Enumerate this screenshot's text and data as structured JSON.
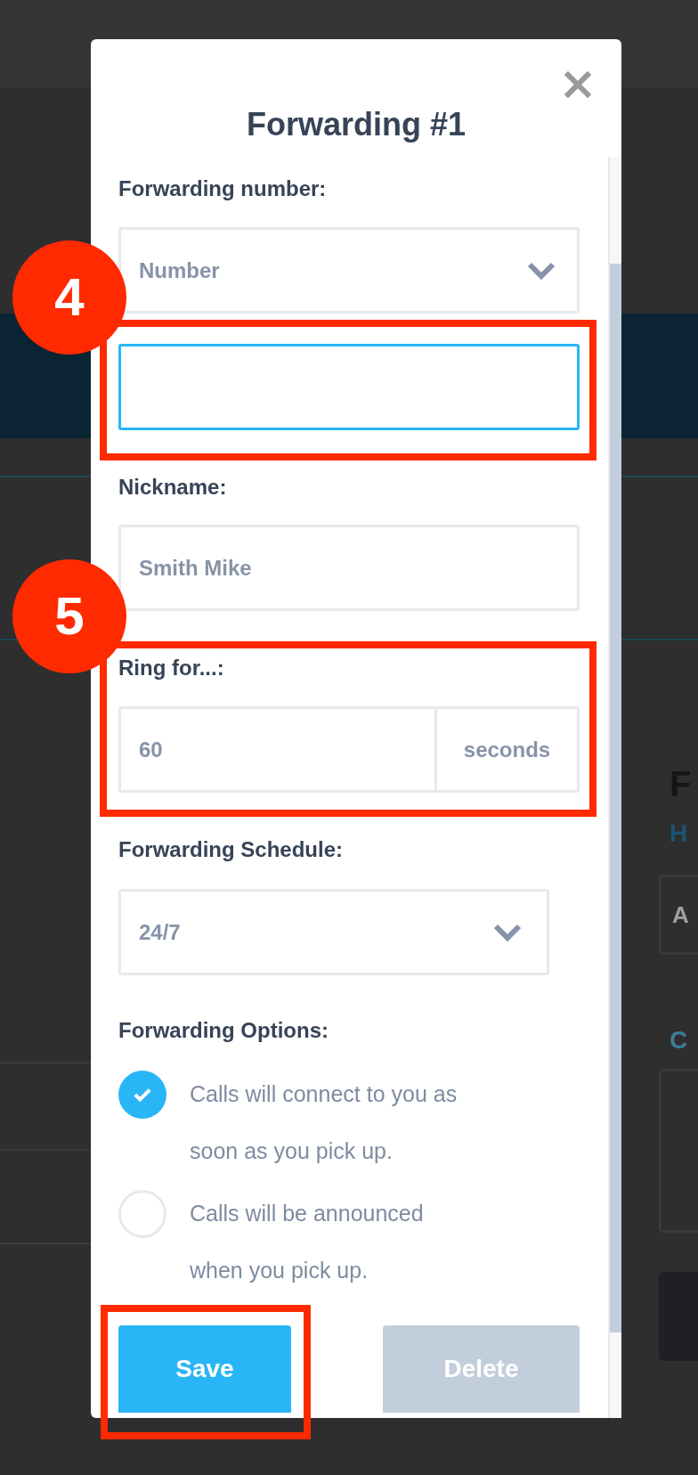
{
  "background_page": {
    "heading": "F",
    "link": "H",
    "field_value": "A",
    "label": "C"
  },
  "dialog": {
    "title": "Forwarding #1",
    "forwarding_number": {
      "label": "Forwarding number:",
      "select_value": "Number",
      "input": {
        "focused": true,
        "highlighted": true,
        "callout": "4"
      }
    },
    "nickname": {
      "label": "Nickname:",
      "value": "Smith Mike"
    },
    "ring_for": {
      "label": "Ring for...:",
      "value": "60",
      "unit": "seconds",
      "highlighted": true,
      "callout": "5"
    },
    "schedule": {
      "label": "Forwarding Schedule:",
      "value": "24/7"
    },
    "options": {
      "label": "Forwarding Options:",
      "items": [
        {
          "lines": [
            "Calls will connect to you as",
            "soon as you pick up."
          ],
          "selected": true
        },
        {
          "lines": [
            "Calls will be announced",
            "when you pick up."
          ],
          "selected": false
        }
      ]
    },
    "buttons": [
      {
        "label": "Save",
        "kind": "primary",
        "highlighted": true
      },
      {
        "label": "Delete",
        "kind": "disabled",
        "highlighted": false
      }
    ]
  }
}
